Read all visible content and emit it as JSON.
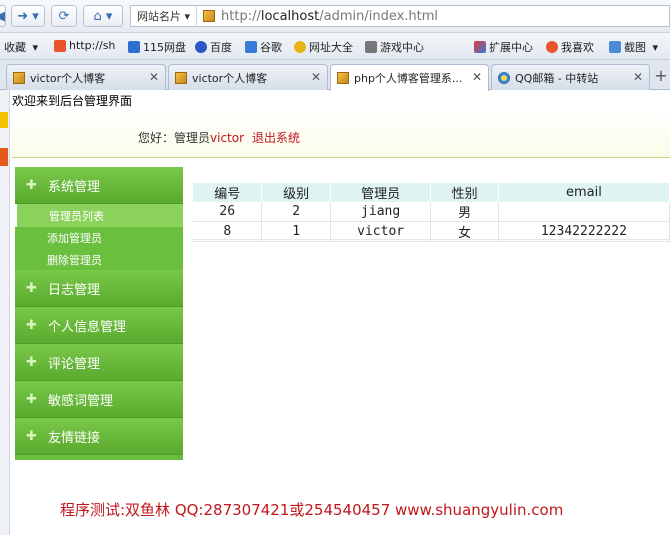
{
  "browser": {
    "address": {
      "site_dropdown": "网站名片",
      "url_prefix": "http://",
      "url_host": "localhost",
      "url_path": "/admin/index.html"
    },
    "bookmarks": {
      "fav_label": "收藏",
      "items": [
        "http://sh",
        "115网盘",
        "百度",
        "谷歌",
        "网址大全",
        "游戏中心"
      ],
      "right": [
        "扩展中心",
        "我喜欢",
        "截图"
      ]
    },
    "tabs": [
      {
        "label": "victor个人博客"
      },
      {
        "label": "victor个人博客"
      },
      {
        "label": "php个人博客管理系..."
      },
      {
        "label": "QQ邮箱 - 中转站"
      }
    ],
    "new_tab": "+",
    "close_glyph": "✕"
  },
  "page": {
    "welcome": "欢迎来到后台管理界面",
    "greeting_prefix": "您好：管理员",
    "username": "victor",
    "logout": "退出系统",
    "footer": "程序测试:双鱼林 QQ:287307421或254540457  www.shuangyulin.com"
  },
  "menu": {
    "sections": [
      {
        "title": "系统管理",
        "subitems": [
          "管理员列表",
          "添加管理员",
          "删除管理员"
        ]
      },
      {
        "title": "日志管理"
      },
      {
        "title": "个人信息管理"
      },
      {
        "title": "评论管理"
      },
      {
        "title": "敏感词管理"
      },
      {
        "title": "友情链接"
      }
    ],
    "plus": "✚"
  },
  "table": {
    "headers": [
      "编号",
      "级别",
      "管理员",
      "性别",
      "email"
    ],
    "rows": [
      [
        "26",
        "2",
        "jiang",
        "男",
        ""
      ],
      [
        "8",
        "1",
        "victor",
        "女",
        "12342222222"
      ]
    ]
  }
}
